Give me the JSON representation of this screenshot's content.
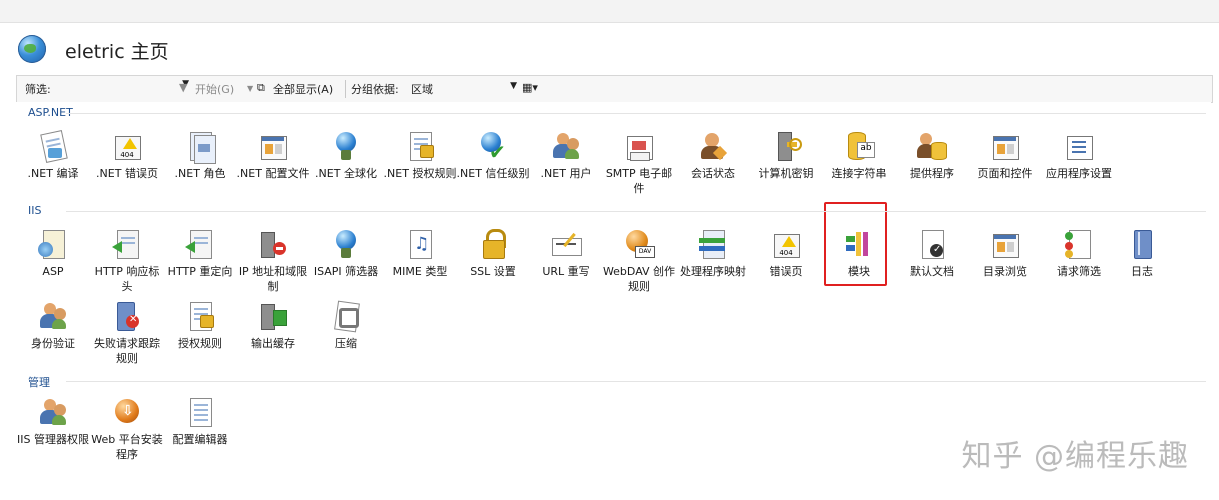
{
  "header": {
    "title": "eletric 主页",
    "icon": "globe-icon"
  },
  "toolbar": {
    "filter_label": "筛选:",
    "filter_value": "",
    "start_label": "开始(G)",
    "show_all_label": "全部显示(A)",
    "group_by_label": "分组依据:",
    "group_by_value": "区域"
  },
  "groups": {
    "aspnet": {
      "title": "ASP.NET",
      "items": [
        {
          "label": ".NET 编译",
          "icon": "net-compile-icon"
        },
        {
          "label": ".NET 错误页",
          "icon": "net-error-page-icon"
        },
        {
          "label": ".NET 角色",
          "icon": "net-roles-icon"
        },
        {
          "label": ".NET 配置文件",
          "icon": "net-profile-icon"
        },
        {
          "label": ".NET 全球化",
          "icon": "net-globalization-icon"
        },
        {
          "label": ".NET 授权规则",
          "icon": "net-authorization-rules-icon"
        },
        {
          "label": ".NET 信任级别",
          "icon": "net-trust-levels-icon"
        },
        {
          "label": ".NET 用户",
          "icon": "net-users-icon"
        },
        {
          "label": "SMTP 电子邮件",
          "icon": "smtp-email-icon"
        },
        {
          "label": "会话状态",
          "icon": "session-state-icon"
        },
        {
          "label": "计算机密钥",
          "icon": "machine-key-icon"
        },
        {
          "label": "连接字符串",
          "icon": "connection-strings-icon"
        },
        {
          "label": "提供程序",
          "icon": "providers-icon"
        },
        {
          "label": "页面和控件",
          "icon": "pages-controls-icon"
        },
        {
          "label": "应用程序设置",
          "icon": "app-settings-icon"
        }
      ]
    },
    "iis": {
      "title": "IIS",
      "items": [
        {
          "label": "ASP",
          "icon": "asp-icon"
        },
        {
          "label": "HTTP 响应标头",
          "icon": "http-response-headers-icon"
        },
        {
          "label": "HTTP 重定向",
          "icon": "http-redirect-icon"
        },
        {
          "label": "IP 地址和域限制",
          "icon": "ip-domain-restrictions-icon"
        },
        {
          "label": "ISAPI 筛选器",
          "icon": "isapi-filters-icon"
        },
        {
          "label": "MIME 类型",
          "icon": "mime-types-icon"
        },
        {
          "label": "SSL 设置",
          "icon": "ssl-lock-icon"
        },
        {
          "label": "URL 重写",
          "icon": "url-rewrite-icon"
        },
        {
          "label": "WebDAV 创作规则",
          "icon": "webdav-icon"
        },
        {
          "label": "处理程序映射",
          "icon": "handler-mappings-icon"
        },
        {
          "label": "错误页",
          "icon": "error-pages-icon"
        },
        {
          "label": "模块",
          "icon": "modules-icon"
        },
        {
          "label": "默认文档",
          "icon": "default-document-icon"
        },
        {
          "label": "目录浏览",
          "icon": "directory-browsing-icon"
        },
        {
          "label": "请求筛选",
          "icon": "request-filtering-icon"
        },
        {
          "label": "日志",
          "icon": "logging-icon"
        },
        {
          "label": "身份验证",
          "icon": "authentication-icon"
        },
        {
          "label": "失败请求跟踪规则",
          "icon": "failed-request-tracing-icon"
        },
        {
          "label": "授权规则",
          "icon": "authorization-rules-icon"
        },
        {
          "label": "输出缓存",
          "icon": "output-caching-icon"
        },
        {
          "label": "压缩",
          "icon": "compression-icon"
        }
      ]
    },
    "management": {
      "title": "管理",
      "items": [
        {
          "label": "IIS 管理器权限",
          "icon": "iis-manager-permissions-icon"
        },
        {
          "label": "Web 平台安装程序",
          "icon": "web-platform-installer-icon"
        },
        {
          "label": "配置编辑器",
          "icon": "configuration-editor-icon"
        }
      ]
    }
  },
  "watermark": "知乎 @编程乐趣",
  "highlight_color": "#e02020"
}
